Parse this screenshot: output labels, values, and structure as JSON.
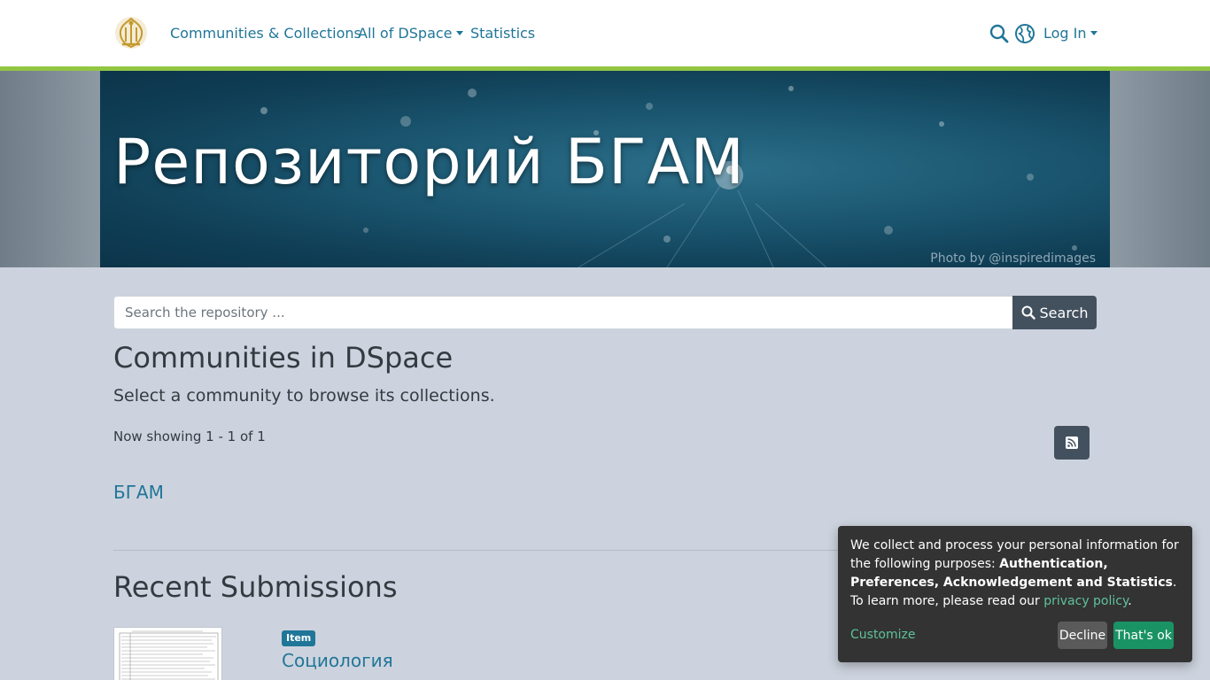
{
  "header": {
    "nav": {
      "communities": "Communities & Collections",
      "all_dspace": "All of DSpace",
      "statistics": "Statistics",
      "login": "Log In"
    }
  },
  "banner": {
    "title": "Репозиторий БГАМ",
    "photo_credit": "Photo by @inspiredimages"
  },
  "search": {
    "placeholder": "Search the repository ...",
    "button_label": "Search"
  },
  "communities": {
    "heading": "Communities in DSpace",
    "lead": "Select a community to browse its collections.",
    "showing": "Now showing 1 - 1 of 1",
    "items": [
      "БГАМ"
    ]
  },
  "recent": {
    "heading": "Recent Submissions",
    "items": [
      {
        "badge": "Item",
        "title": "Социология"
      }
    ]
  },
  "cookie": {
    "text_intro": "We collect and process your personal information for the following purposes: ",
    "purposes": "Authentication, Preferences, Acknowledgement and Statistics",
    "period": ".",
    "learn_more": "To learn more, please read our ",
    "privacy_link": "privacy policy",
    "learn_end": ".",
    "customize": "Customize",
    "decline": "Decline",
    "accept": "That's ok"
  },
  "colors": {
    "link": "#207698",
    "accent_bar": "#92c642",
    "button_dark": "#43515f",
    "cookie_accent": "#1a9364"
  },
  "icons": [
    "logo-emblem",
    "search-icon",
    "globe-icon",
    "rss-icon",
    "search-icon"
  ]
}
